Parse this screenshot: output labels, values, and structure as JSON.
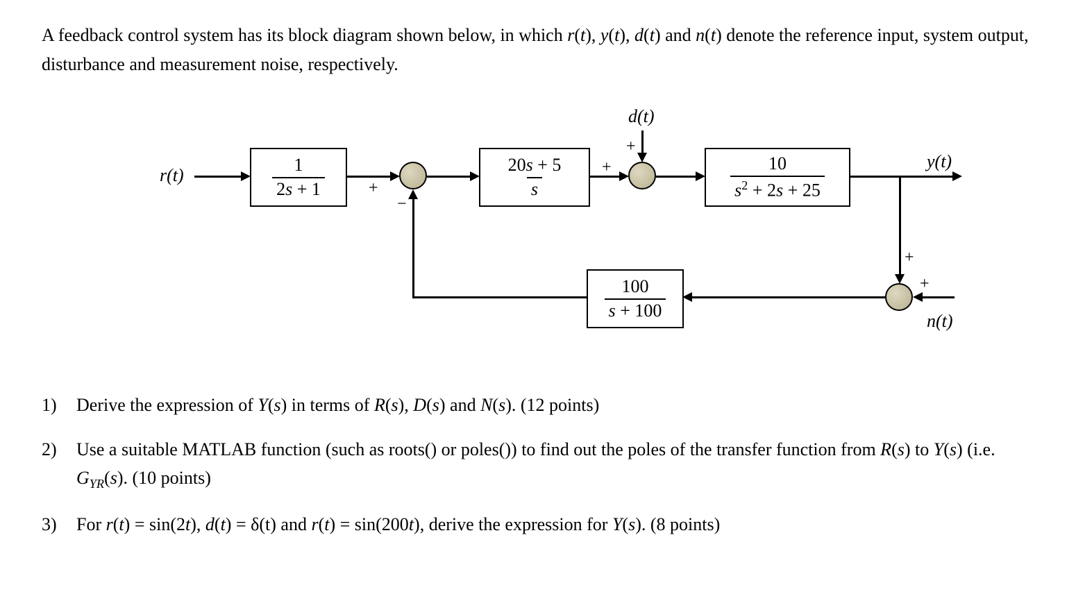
{
  "intro": "A feedback control system has its block diagram shown below, in which r(t), y(t), d(t) and n(t) denote the reference input, system output, disturbance and measurement noise, respectively.",
  "diagram": {
    "signals": {
      "r": "r(t)",
      "y": "y(t)",
      "d": "d(t)",
      "n": "n(t)"
    },
    "blocks": {
      "prefilter": {
        "num": "1",
        "den": "2s + 1"
      },
      "controller": {
        "num": "20s + 5",
        "den": "s"
      },
      "plant": {
        "num": "10",
        "den": "s² + 2s + 25"
      },
      "sensor": {
        "num": "100",
        "den": "s + 100"
      }
    },
    "signs": {
      "sum1_top": "+",
      "sum1_bottom": "−",
      "sum2_left": "+",
      "sum2_top": "+",
      "sum3_top": "+",
      "sum3_right": "+"
    }
  },
  "questions": [
    {
      "num": "1)",
      "text": "Derive the expression of Y(s) in terms of R(s), D(s) and N(s). (12 points)"
    },
    {
      "num": "2)",
      "text": "Use a suitable MATLAB function (such as roots() or poles()) to find out the poles of the transfer function from R(s) to Y(s) (i.e. G_YR(s). (10 points)"
    },
    {
      "num": "3)",
      "text": "For r(t) = sin(2t), d(t) = δ(t) and r(t) = sin(200t), derive the expression for Y(s). (8 points)"
    }
  ]
}
